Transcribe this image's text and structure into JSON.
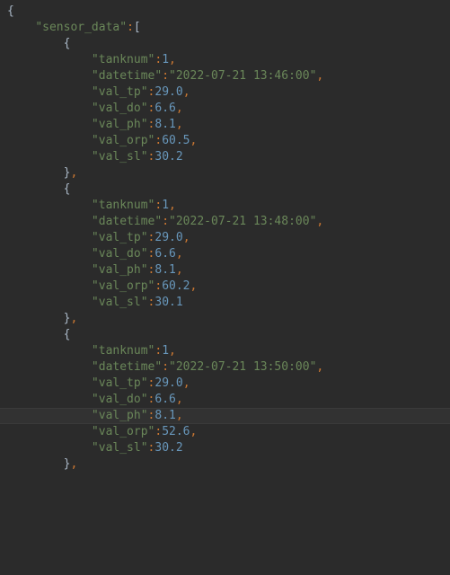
{
  "root_key": "sensor_data",
  "entries": [
    {
      "fields": [
        {
          "key": "tanknum",
          "value": "1",
          "type": "number"
        },
        {
          "key": "datetime",
          "value": "2022-07-21 13:46:00",
          "type": "string"
        },
        {
          "key": "val_tp",
          "value": "29.0",
          "type": "number"
        },
        {
          "key": "val_do",
          "value": "6.6",
          "type": "number"
        },
        {
          "key": "val_ph",
          "value": "8.1",
          "type": "number"
        },
        {
          "key": "val_orp",
          "value": "60.5",
          "type": "number"
        },
        {
          "key": "val_sl",
          "value": "30.2",
          "type": "number"
        }
      ]
    },
    {
      "fields": [
        {
          "key": "tanknum",
          "value": "1",
          "type": "number"
        },
        {
          "key": "datetime",
          "value": "2022-07-21 13:48:00",
          "type": "string"
        },
        {
          "key": "val_tp",
          "value": "29.0",
          "type": "number"
        },
        {
          "key": "val_do",
          "value": "6.6",
          "type": "number"
        },
        {
          "key": "val_ph",
          "value": "8.1",
          "type": "number"
        },
        {
          "key": "val_orp",
          "value": "60.2",
          "type": "number"
        },
        {
          "key": "val_sl",
          "value": "30.1",
          "type": "number"
        }
      ]
    },
    {
      "fields": [
        {
          "key": "tanknum",
          "value": "1",
          "type": "number"
        },
        {
          "key": "datetime",
          "value": "2022-07-21 13:50:00",
          "type": "string"
        },
        {
          "key": "val_tp",
          "value": "29.0",
          "type": "number"
        },
        {
          "key": "val_do",
          "value": "6.6",
          "type": "number"
        },
        {
          "key": "val_ph",
          "value": "8.1",
          "type": "number",
          "highlight": true
        },
        {
          "key": "val_orp",
          "value": "52.6",
          "type": "number"
        },
        {
          "key": "val_sl",
          "value": "30.2",
          "type": "number"
        }
      ]
    }
  ],
  "indent_unit": "    "
}
